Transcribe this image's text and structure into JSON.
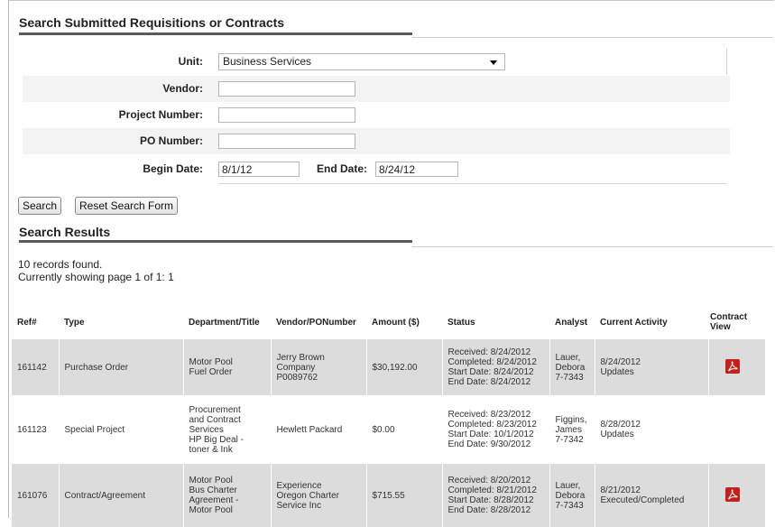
{
  "search_form": {
    "title": "Search Submitted Requisitions or Contracts",
    "unit_label": "Unit:",
    "unit_value": "Business Services",
    "vendor_label": "Vendor:",
    "vendor_value": "",
    "project_label": "Project Number:",
    "project_value": "",
    "po_label": "PO Number:",
    "po_value": "",
    "begin_label": "Begin Date:",
    "begin_value": "8/1/12",
    "end_label": "End Date:",
    "end_value": "8/24/12",
    "search_button": "Search",
    "reset_button": "Reset Search Form"
  },
  "results": {
    "title": "Search Results",
    "count_text": "10 records found.",
    "page_text": "Currently showing page 1 of 1: 1",
    "columns": [
      "Ref#",
      "Type",
      "Department/Title",
      "Vendor/PONumber",
      "Amount ($)",
      "Status",
      "Analyst",
      "Current Activity",
      "Contract View"
    ],
    "rows": [
      {
        "ref": "161142",
        "type": "Purchase Order",
        "dept": [
          "Motor Pool",
          "Fuel Order"
        ],
        "vendor": [
          "Jerry Brown",
          "Company",
          "P0089762"
        ],
        "amount": "$30,192.00",
        "status": [
          "Received: 8/24/2012",
          "Completed: 8/24/2012",
          "Start Date: 8/24/2012",
          "End Date: 8/24/2012"
        ],
        "analyst": [
          "Lauer,",
          "Debora",
          "7-7343"
        ],
        "activity": [
          "8/24/2012",
          "Updates"
        ],
        "pdf_icon": "pdf-icon",
        "has_pdf": true,
        "shaded": true
      },
      {
        "ref": "161123",
        "type": "Special Project",
        "dept": [
          "Procurement",
          "and Contract",
          "Services",
          "HP Big Deal -",
          "toner & Ink"
        ],
        "vendor": [
          "Hewlett Packard"
        ],
        "amount": "$0.00",
        "status": [
          "Received: 8/23/2012",
          "Completed: 8/23/2012",
          "Start Date: 10/1/2012",
          "End Date: 9/30/2012"
        ],
        "analyst": [
          "Figgins,",
          "James",
          "7-7342"
        ],
        "activity": [
          "8/28/2012",
          "Updates"
        ],
        "pdf_icon": "",
        "has_pdf": false,
        "shaded": false
      },
      {
        "ref": "161076",
        "type": "Contract/Agreement",
        "dept": [
          "Motor Pool",
          "Bus Charter",
          "Agreement -",
          "Motor Pool"
        ],
        "vendor": [
          "Experience",
          "Oregon Charter",
          "Service Inc"
        ],
        "amount": "$715.55",
        "status": [
          "Received: 8/20/2012",
          "Completed: 8/21/2012",
          "Start Date: 8/28/2012",
          "End Date: 8/28/2012"
        ],
        "analyst": [
          "Lauer,",
          "Debora",
          "7-7343"
        ],
        "activity": [
          "8/21/2012",
          "Executed/Completed"
        ],
        "pdf_icon": "pdf-icon",
        "has_pdf": true,
        "shaded": true
      }
    ]
  }
}
